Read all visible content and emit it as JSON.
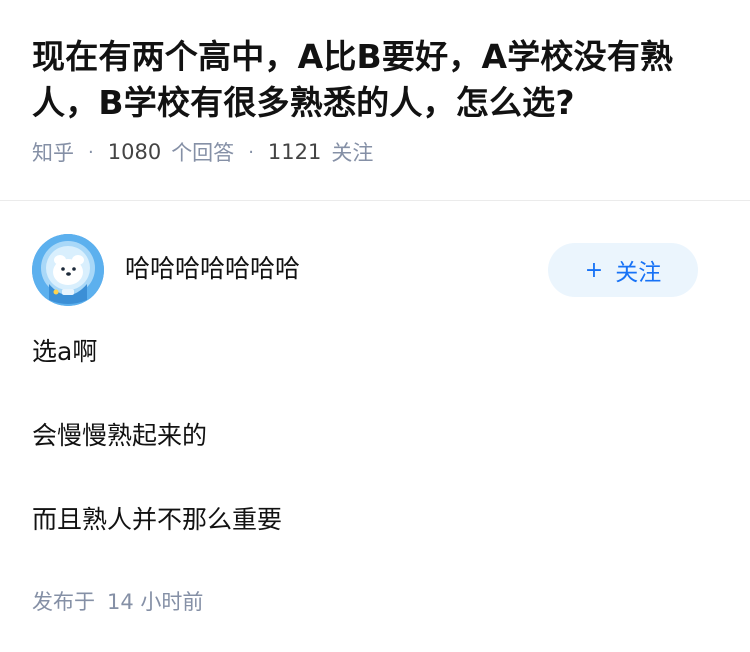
{
  "question": {
    "title": "现在有两个高中，A比B要好，A学校没有熟人，B学校有很多熟悉的人，怎么选?",
    "source": "知乎",
    "answer_count": "1080",
    "answer_label": "个回答",
    "follow_count": "1121",
    "follow_label": "关注"
  },
  "answer": {
    "author": {
      "name": "哈哈哈哈哈哈哈",
      "avatar_icon": "astronaut-bear-avatar"
    },
    "follow_button": {
      "icon": "+",
      "label": "关注"
    },
    "paragraphs": [
      "选a啊",
      "会慢慢熟起来的",
      "而且熟人并不那么重要"
    ],
    "published_label": "发布于",
    "published_time": "14 小时前"
  },
  "colors": {
    "link_blue": "#1772f6",
    "follow_bg": "#ebf5fd",
    "meta_gray": "#8590a6"
  }
}
